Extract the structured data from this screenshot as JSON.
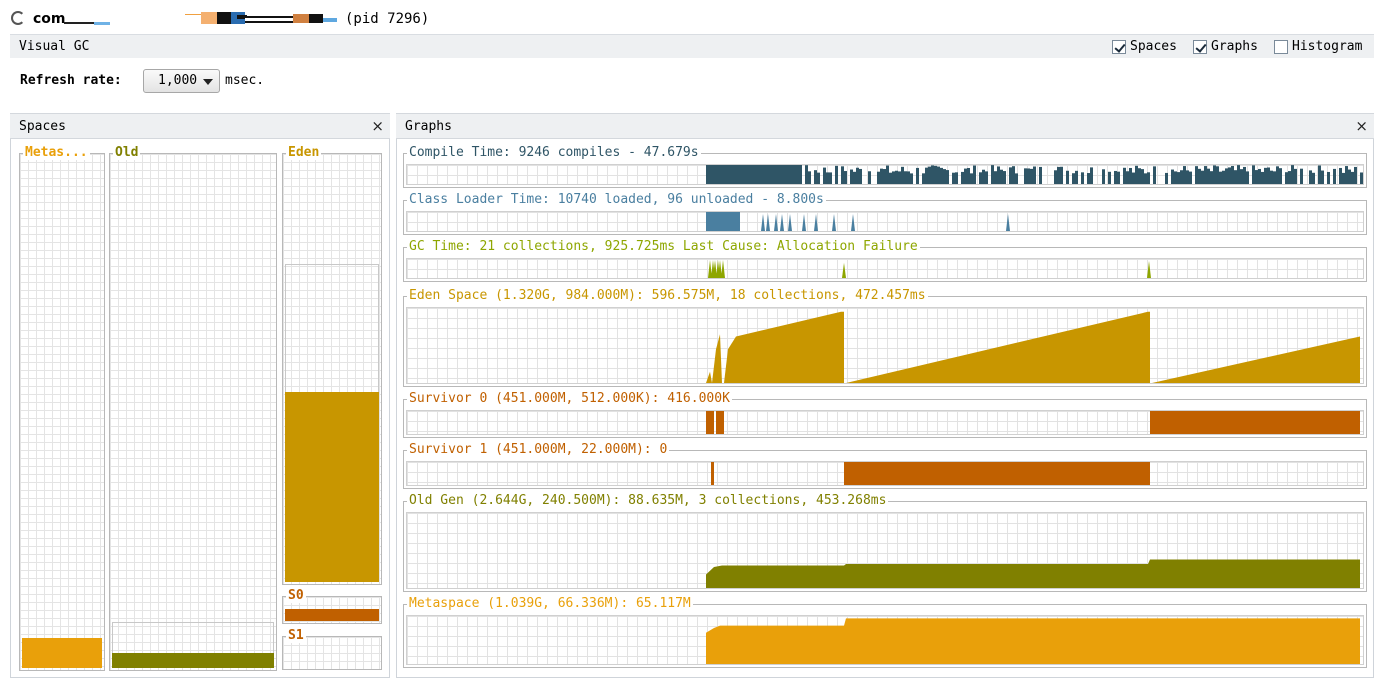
{
  "window": {
    "app_name": "com",
    "pid": "(pid 7296)"
  },
  "toolbar": {
    "title": "Visual GC",
    "checkboxes": [
      {
        "label": "Spaces",
        "checked": true
      },
      {
        "label": "Graphs",
        "checked": true
      },
      {
        "label": "Histogram",
        "checked": false
      }
    ]
  },
  "refresh": {
    "label": "Refresh rate:",
    "value": "1,000",
    "unit": "msec."
  },
  "spaces_panel": {
    "title": "Spaces",
    "close": "×",
    "columns": [
      {
        "label": "Metas...",
        "color": "#e9a00a",
        "fill_fraction": 0.06
      },
      {
        "label": "Old",
        "color": "#808000",
        "fill_fraction": 0.03
      },
      {
        "label": "Eden",
        "color": "#c89600",
        "fill_fraction": 0.45
      },
      {
        "label": "S0",
        "color": "#c06000",
        "fill_fraction": 0.8
      },
      {
        "label": "S1",
        "color": "#c06000",
        "fill_fraction": 0.0
      }
    ]
  },
  "graphs_panel": {
    "title": "Graphs",
    "close": "×",
    "graphs": [
      {
        "label": "Compile Time: 9246 compiles - 47.679s",
        "color": "#2f5566",
        "kind": "compile"
      },
      {
        "label": "Class Loader Time: 10740 loaded, 96 unloaded - 8.800s",
        "color": "#4a7fa0",
        "kind": "classloader"
      },
      {
        "label": "GC Time: 21 collections, 925.725ms Last Cause: Allocation Failure",
        "color": "#8ea600",
        "kind": "gctime"
      },
      {
        "label": "Eden Space (1.320G, 984.000M): 596.575M, 18 collections, 472.457ms",
        "color": "#c89600",
        "kind": "eden"
      },
      {
        "label": "Survivor 0 (451.000M, 512.000K): 416.000K",
        "color": "#c06000",
        "kind": "s0"
      },
      {
        "label": "Survivor 1 (451.000M, 22.000M): 0",
        "color": "#c06000",
        "kind": "s1"
      },
      {
        "label": "Old Gen (2.644G, 240.500M): 88.635M, 3 collections, 453.268ms",
        "color": "#808000",
        "kind": "old"
      },
      {
        "label": "Metaspace (1.039G, 66.336M): 65.117M",
        "color": "#e9a00a",
        "kind": "meta"
      }
    ]
  }
}
